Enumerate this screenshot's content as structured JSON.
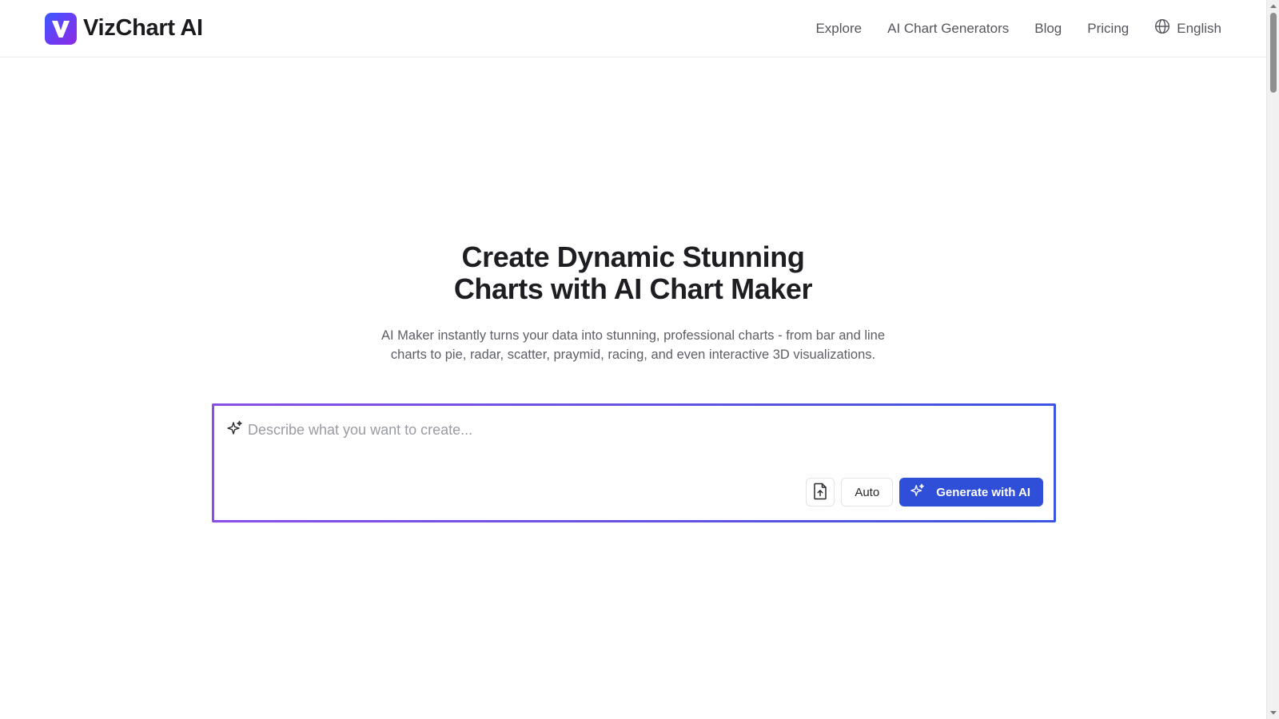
{
  "header": {
    "brand_name": "VizChart AI",
    "nav": [
      {
        "label": "Explore"
      },
      {
        "label": "AI Chart Generators"
      },
      {
        "label": "Blog"
      },
      {
        "label": "Pricing"
      }
    ],
    "language": "English",
    "icons": {
      "logo": "v-logo-icon",
      "language": "globe-icon"
    }
  },
  "hero": {
    "title_line1": "Create Dynamic Stunning",
    "title_line2": "Charts with AI Chart Maker",
    "subtitle_line1": "AI Maker instantly turns your data into stunning, professional charts - from bar and line",
    "subtitle_line2": "charts to pie, radar, scatter, praymid, racing, and even interactive 3D visualizations."
  },
  "prompt": {
    "placeholder": "Describe what you want to create...",
    "value": "",
    "mode_label": "Auto",
    "generate_label": "Generate with AI",
    "icons": {
      "prompt": "sparkle-icon",
      "upload": "file-upload-icon",
      "generate": "sparkle-icon"
    }
  },
  "colors": {
    "accent": "#2f4fd8",
    "border_gradient_start": "#8b4dea",
    "border_gradient_end": "#3b55e2",
    "logo_gradient_start": "#3b5bff",
    "logo_gradient_end": "#8a2be2"
  }
}
